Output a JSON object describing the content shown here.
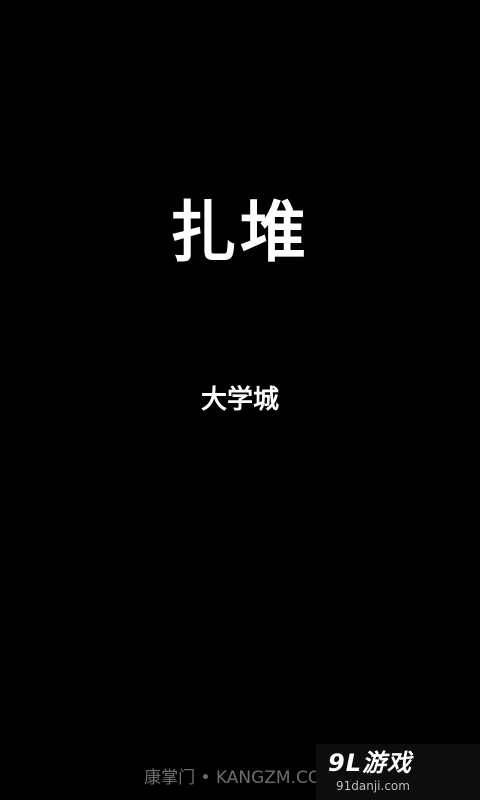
{
  "splash": {
    "title": "扎堆",
    "subtitle": "大学城",
    "footer": "康掌门 • KANGZM.COM"
  },
  "watermark": {
    "logo_text": "9L游戏",
    "url": "91danji.com"
  },
  "colors": {
    "background": "#000000",
    "title": "#ffffff",
    "footer": "#6e6e6e"
  }
}
